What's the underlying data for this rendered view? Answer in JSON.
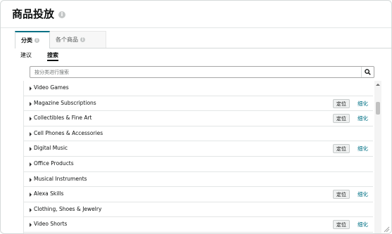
{
  "header": {
    "title": "商品投放",
    "info_icon": "i"
  },
  "tabs": [
    {
      "label": "分类",
      "active": true,
      "info_icon": "i"
    },
    {
      "label": "各个商品",
      "active": false,
      "info_icon": "i"
    }
  ],
  "subtabs": [
    {
      "label": "建议",
      "active": false
    },
    {
      "label": "搜索",
      "active": true
    }
  ],
  "search": {
    "placeholder": "按分类进行搜索",
    "value": "",
    "icon": "search-icon"
  },
  "actions": {
    "locate_label": "定位",
    "refine_label": "细化"
  },
  "categories": [
    {
      "label": "Video Games",
      "has_actions": false
    },
    {
      "label": "Magazine Subscriptions",
      "has_actions": true
    },
    {
      "label": "Collectibles & Fine Art",
      "has_actions": true
    },
    {
      "label": "Cell Phones & Accessories",
      "has_actions": false
    },
    {
      "label": "Digital Music",
      "has_actions": true
    },
    {
      "label": "Office Products",
      "has_actions": false
    },
    {
      "label": "Musical Instruments",
      "has_actions": false
    },
    {
      "label": "Alexa Skills",
      "has_actions": true
    },
    {
      "label": "Clothing, Shoes & Jewelry",
      "has_actions": false
    },
    {
      "label": "Video Shorts",
      "has_actions": true
    }
  ],
  "colors": {
    "accent": "#007185",
    "border": "#d5d9d9",
    "button_bg": "#eef0f0"
  }
}
